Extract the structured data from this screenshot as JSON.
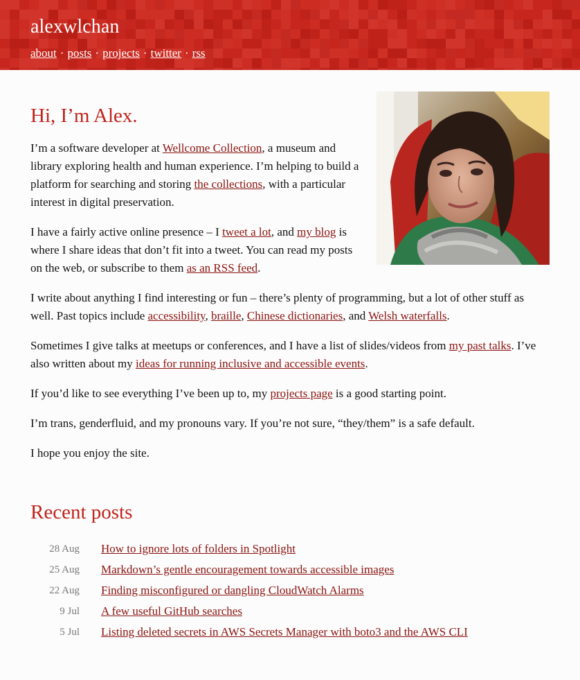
{
  "site": {
    "title": "alexwlchan"
  },
  "nav": [
    {
      "label": "about"
    },
    {
      "label": "posts"
    },
    {
      "label": "projects"
    },
    {
      "label": "twitter"
    },
    {
      "label": "rss"
    }
  ],
  "nav_separator": "·",
  "colors": {
    "header_red": "#c6261e",
    "heading_red": "#c0221b",
    "link_red": "#8a1410",
    "date_gray": "#777777"
  },
  "intro": {
    "heading": "Hi, I’m Alex.",
    "p1": {
      "t1": "I’m a software developer at ",
      "link1": "Wellcome Collection",
      "t2": ", a museum and library exploring health and human experience. I’m helping to build a platform for searching and storing ",
      "link2": "the collections",
      "t3": ", with a particular interest in digital preservation."
    },
    "p2": {
      "t1": "I have a fairly active online presence – I ",
      "link1": "tweet a lot",
      "t2": ", and ",
      "link2": "my blog",
      "t3": " is where I share ideas that don’t fit into a tweet. You can read my posts on the web, or subscribe to them ",
      "link3": "as an RSS feed",
      "t4": "."
    },
    "p3": {
      "t1": "I write about anything I find interesting or fun – there’s plenty of programming, but a lot of other stuff as well. Past topics include ",
      "link1": "accessibility",
      "t2": ", ",
      "link2": "braille",
      "t3": ", ",
      "link3": "Chinese dictionaries",
      "t4": ", and ",
      "link4": "Welsh waterfalls",
      "t5": "."
    },
    "p4": {
      "t1": "Sometimes I give talks at meetups or conferences, and I have a list of slides/videos from ",
      "link1": "my past talks",
      "t2": ". I’ve also written about my ",
      "link2": "ideas for running inclusive and accessible events",
      "t3": "."
    },
    "p5": {
      "t1": "If you’d like to see everything I’ve been up to, my ",
      "link1": "projects page",
      "t2": " is a good starting point."
    },
    "p6": "I’m trans, genderfluid, and my pronouns vary. If you’re not sure, “they/them” is a safe default.",
    "p7": "I hope you enjoy the site."
  },
  "portrait": {
    "icon": "portrait-photo"
  },
  "recent": {
    "heading": "Recent posts",
    "posts": [
      {
        "date": "28 Aug",
        "title": "How to ignore lots of folders in Spotlight"
      },
      {
        "date": "25 Aug",
        "title": "Markdown’s gentle encouragement towards accessible images"
      },
      {
        "date": "22 Aug",
        "title": "Finding misconfigured or dangling CloudWatch Alarms"
      },
      {
        "date": "9 Jul",
        "title": "A few useful GitHub searches"
      },
      {
        "date": "5 Jul",
        "title": "Listing deleted secrets in AWS Secrets Manager with boto3 and the AWS CLI"
      }
    ]
  }
}
